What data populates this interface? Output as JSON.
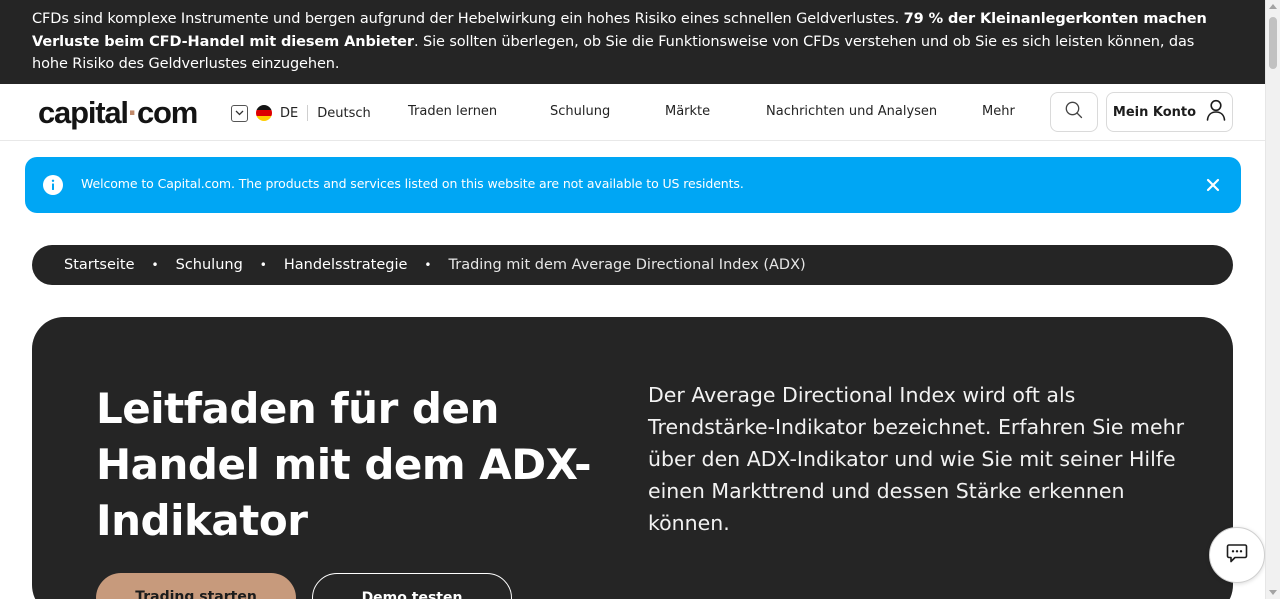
{
  "risk_banner": {
    "text_before": "CFDs sind komplexe Instrumente und bergen aufgrund der Hebelwirkung ein hohes Risiko eines schnellen Geldverlustes. ",
    "text_bold": "79 % der Kleinanlegerkonten machen Verluste beim CFD-Handel mit diesem Anbieter",
    "text_after": ". Sie sollten überlegen, ob Sie die Funktionsweise von CFDs verstehen und ob Sie es sich leisten können, das hohe Risiko des Geldverlustes einzugehen."
  },
  "header": {
    "logo_left": "capital",
    "logo_dot": "·",
    "logo_right": "com",
    "lang_code": "DE",
    "lang_name": "Deutsch",
    "nav": [
      "Traden lernen",
      "Schulung",
      "Märkte",
      "Nachrichten und Analysen",
      "Mehr"
    ],
    "account_label": "Mein Konto",
    "search_icon": "search-icon",
    "account_icon": "user-icon"
  },
  "notice": {
    "text": "Welcome to Capital.com. The products and services listed on this website are not available to US residents.",
    "info_icon": "info-icon",
    "close_icon": "close-icon"
  },
  "breadcrumb": {
    "items": [
      "Startseite",
      "Schulung",
      "Handelsstrategie"
    ],
    "current": "Trading mit dem Average Directional Index (ADX)",
    "separator": "•"
  },
  "hero": {
    "title": "Leitfaden für den Handel mit dem ADX-Indikator",
    "lead": "Der Average Directional Index wird oft als Trendstärke-Indikator bezeichnet. Erfahren Sie mehr über den ADX-Indikator und wie Sie mit seiner Hilfe einen Markttrend und dessen Stärke erkennen können.",
    "primary_button": "Trading starten",
    "secondary_button": "Demo testen"
  },
  "colors": {
    "dark": "#252525",
    "accent": "#c79a7c",
    "notice_blue": "#00a6f4"
  },
  "chat": {
    "icon": "chat-icon"
  }
}
